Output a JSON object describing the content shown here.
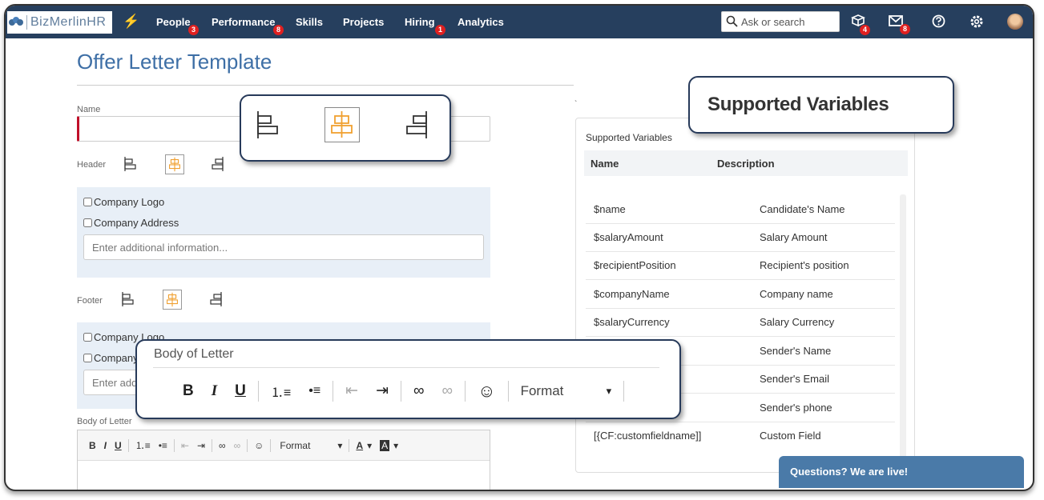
{
  "app": {
    "logo_text": "BizMerlinHR"
  },
  "nav": [
    {
      "label": "People",
      "badge": "3"
    },
    {
      "label": "Performance",
      "badge": "8"
    },
    {
      "label": "Skills",
      "badge": ""
    },
    {
      "label": "Projects",
      "badge": ""
    },
    {
      "label": "Hiring",
      "badge": "1"
    },
    {
      "label": "Analytics",
      "badge": ""
    }
  ],
  "search": {
    "placeholder": "Ask or search"
  },
  "topicons": {
    "box_badge": "4",
    "mail_badge": "8"
  },
  "page": {
    "title": "Offer Letter Template"
  },
  "form": {
    "name_label": "Name",
    "header_label": "Header",
    "footer_label": "Footer",
    "company_logo": "Company Logo",
    "company_address": "Company Address",
    "additional_placeholder": "Enter additional information...",
    "footer_logo": "Company Logo",
    "footer_address": "Company",
    "footer_additional": "Enter add",
    "body_label": "Body of Letter",
    "format_label": "Format"
  },
  "variables": {
    "title": "Supported Variables",
    "col_name": "Name",
    "col_description": "Description",
    "rows": [
      {
        "name": "$name",
        "description": "Candidate's Name"
      },
      {
        "name": "$salaryAmount",
        "description": "Salary Amount"
      },
      {
        "name": "$recipientPosition",
        "description": "Recipient's position"
      },
      {
        "name": "$companyName",
        "description": "Company name"
      },
      {
        "name": "$salaryCurrency",
        "description": "Salary Currency"
      },
      {
        "name": "",
        "description": "Sender's Name"
      },
      {
        "name": "",
        "description": "Sender's Email"
      },
      {
        "name": "",
        "description": "Sender's phone"
      },
      {
        "name": "[{CF:customfieldname]]",
        "description": "Custom Field"
      }
    ]
  },
  "callouts": {
    "supported_variables": "Supported Variables",
    "body_of_letter": "Body of Letter",
    "format": "Format"
  },
  "chat": {
    "label": "Questions? We are live!"
  },
  "colors": {
    "topbar": "#263f5e",
    "accent": "#3e6fa6",
    "required": "#c0102a",
    "badge": "#e02020",
    "chat": "#4a7aa8",
    "align_selected": "#f0a030"
  }
}
